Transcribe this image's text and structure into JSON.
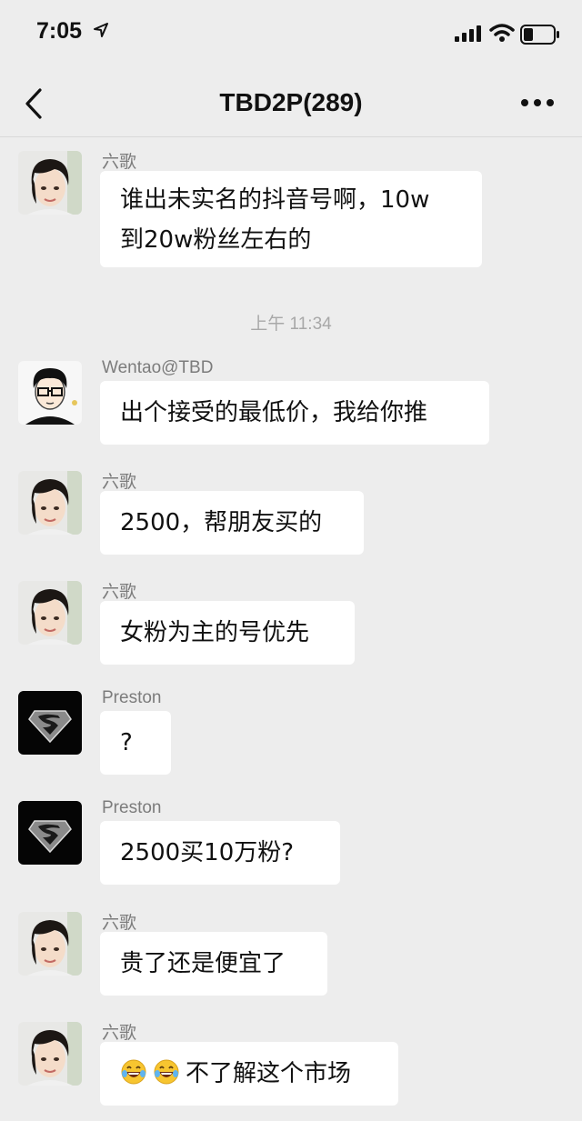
{
  "status_bar": {
    "time": "7:05"
  },
  "header": {
    "title": "TBD2P(289)"
  },
  "timestamp": "上午 11:34",
  "messages": [
    {
      "sender": "六歌",
      "text_line1": "谁出未实名的抖音号啊，10w",
      "text_line2": "到20w粉丝左右的",
      "avatar": "woman-avatar"
    },
    {
      "sender": "Wentao@TBD",
      "text": "出个接受的最低价，我给你推",
      "avatar": "cartoon-man-avatar"
    },
    {
      "sender": "六歌",
      "text": "2500，帮朋友买的",
      "avatar": "woman-avatar"
    },
    {
      "sender": "六歌",
      "text": "女粉为主的号优先",
      "avatar": "woman-avatar"
    },
    {
      "sender": "Preston",
      "text": "?",
      "avatar": "superman-logo-avatar"
    },
    {
      "sender": "Preston",
      "text": "2500买10万粉?",
      "avatar": "superman-logo-avatar"
    },
    {
      "sender": "六歌",
      "text": "贵了还是便宜了",
      "avatar": "woman-avatar"
    },
    {
      "sender": "六歌",
      "text": "不了解这个市场",
      "emojis": [
        "laughing-tears-emoji",
        "laughing-tears-emoji"
      ],
      "avatar": "woman-avatar"
    }
  ],
  "colors": {
    "background": "#ededed",
    "bubble": "#ffffff",
    "sender": "#7c7c7c",
    "timestamp": "#a8a8a8"
  }
}
